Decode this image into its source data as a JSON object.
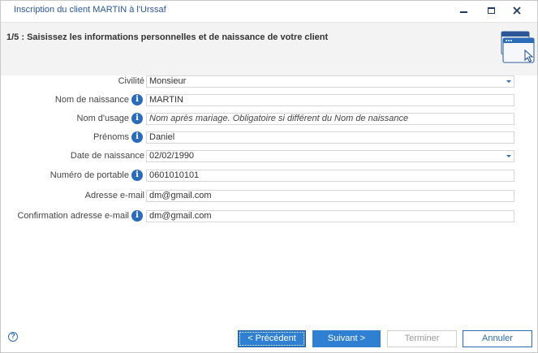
{
  "window": {
    "title": "Inscription du client MARTIN à l'Urssaf"
  },
  "header": {
    "step_title": "1/5 : Saisissez les informations personnelles et de naissance de votre client"
  },
  "form": {
    "civilite": {
      "label": "Civilité",
      "value": "Monsieur"
    },
    "nom_naissance": {
      "label": "Nom de naissance",
      "value": "MARTIN"
    },
    "nom_usage": {
      "label": "Nom d'usage",
      "placeholder": "Nom après mariage. Obligatoire si différent du Nom de naissance"
    },
    "prenoms": {
      "label": "Prénoms",
      "value": "Daniel"
    },
    "date_naissance": {
      "label": "Date de naissance",
      "value": "02/02/1990"
    },
    "portable": {
      "label": "Numéro de portable",
      "value": "0601010101"
    },
    "email": {
      "label": "Adresse e-mail",
      "value": "dm@gmail.com"
    },
    "email_confirm": {
      "label": "Confirmation adresse e-mail",
      "value": "dm@gmail.com"
    }
  },
  "footer": {
    "help_symbol": "?",
    "prev_label": "< Précédent",
    "next_label": "Suivant >",
    "finish_label": "Terminer",
    "cancel_label": "Annuler"
  },
  "colors": {
    "accent": "#2f7fd3",
    "title_text": "#2b5797",
    "info_icon": "#2b6cb8"
  }
}
